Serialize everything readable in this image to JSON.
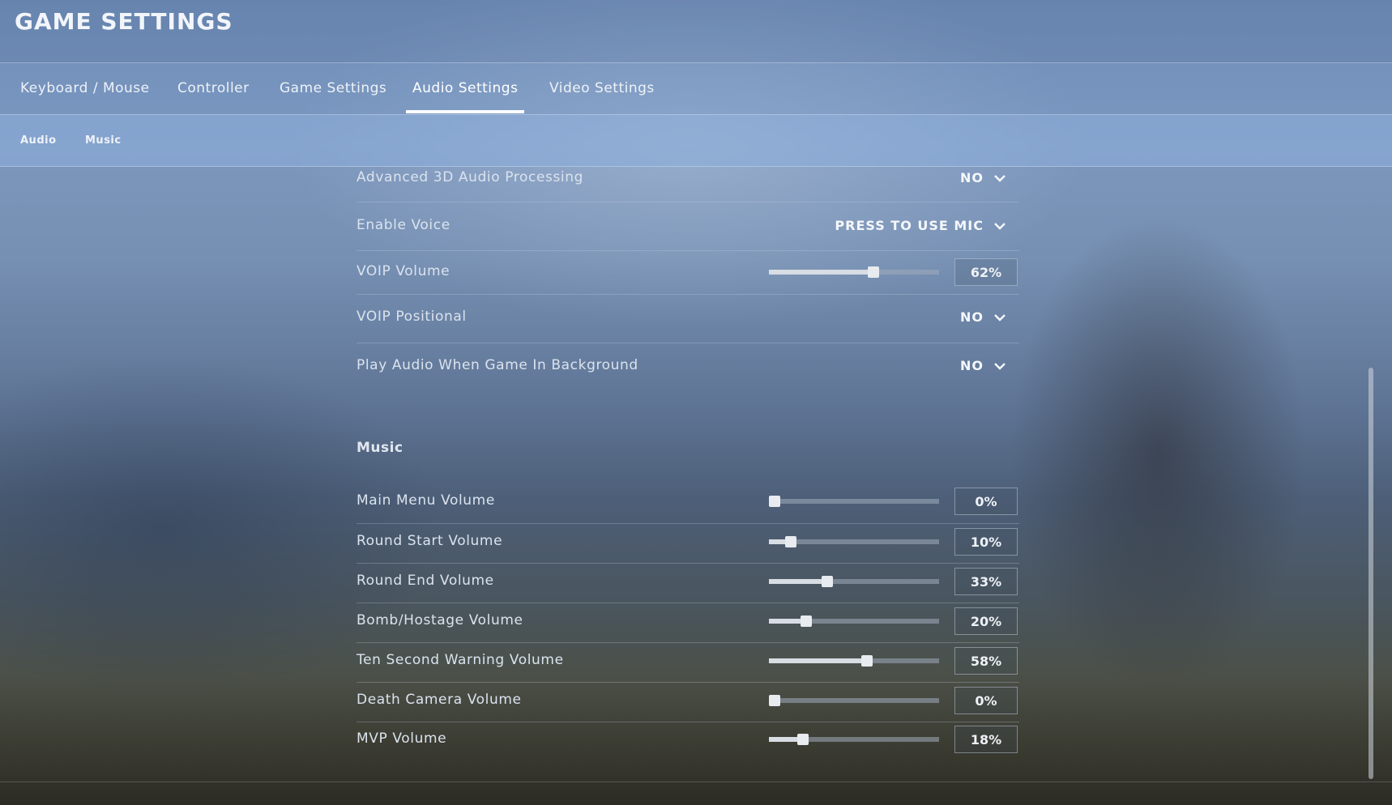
{
  "header": {
    "title": "GAME SETTINGS"
  },
  "tabs": [
    {
      "label": "Keyboard / Mouse",
      "active": false
    },
    {
      "label": "Controller",
      "active": false
    },
    {
      "label": "Game Settings",
      "active": false
    },
    {
      "label": "Audio Settings",
      "active": true
    },
    {
      "label": "Video Settings",
      "active": false
    }
  ],
  "subtabs": [
    {
      "label": "Audio"
    },
    {
      "label": "Music"
    }
  ],
  "audio_settings": [
    {
      "label": "Advanced 3D Audio Processing",
      "type": "dropdown",
      "value": "NO"
    },
    {
      "label": "Enable Voice",
      "type": "dropdown",
      "value": "PRESS TO USE MIC"
    },
    {
      "label": "VOIP Volume",
      "type": "slider",
      "percent": 62,
      "value": "62%"
    },
    {
      "label": "VOIP Positional",
      "type": "dropdown",
      "value": "NO"
    },
    {
      "label": "Play Audio When Game In Background",
      "type": "dropdown",
      "value": "NO"
    }
  ],
  "music_section": {
    "title": "Music",
    "settings": [
      {
        "label": "Main Menu Volume",
        "percent": 0,
        "value": "0%"
      },
      {
        "label": "Round Start Volume",
        "percent": 10,
        "value": "10%"
      },
      {
        "label": "Round End Volume",
        "percent": 33,
        "value": "33%"
      },
      {
        "label": "Bomb/Hostage Volume",
        "percent": 20,
        "value": "20%"
      },
      {
        "label": "Ten Second Warning Volume",
        "percent": 58,
        "value": "58%"
      },
      {
        "label": "Death Camera Volume",
        "percent": 0,
        "value": "0%"
      },
      {
        "label": "MVP Volume",
        "percent": 18,
        "value": "18%"
      }
    ]
  },
  "icons": {
    "dropdown": "chevron-down-icon"
  },
  "colors": {
    "text": "#dbe3ee",
    "accent": "#ffffff"
  }
}
